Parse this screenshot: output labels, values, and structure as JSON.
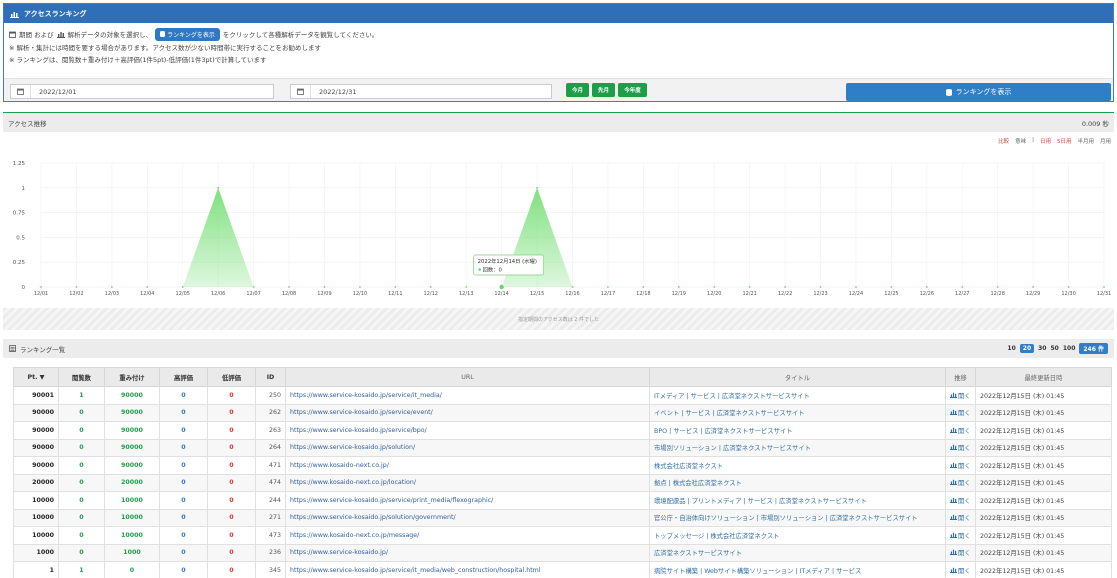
{
  "top_panel": {
    "title": "アクセスランキング",
    "instr_prefix": "期間 および",
    "instr_mid": "解析データの対象を選択し、",
    "instr_button": "ランキングを表示",
    "instr_suffix": "をクリックして各種解析データを観覧してください。",
    "note1": "※ 解析・集計には時間を要する場合があります。アクセス数が少ない時間帯に実行することをお勧めします",
    "note2": "※ ランキングは、閲覧数＋重み付け＋高評価(1件5pt)-低評価(1件3pt)で計算しています",
    "start_date": "2022/12/01",
    "end_date": "2022/12/31",
    "btn_this_month": "今月",
    "btn_last_month": "先月",
    "btn_this_year": "今年度",
    "show_button": "ランキングを表示"
  },
  "access_panel": {
    "title": "アクセス推移",
    "elapsed": "0.009 秒",
    "controls": {
      "compare": "比較",
      "detail": "意味",
      "sep": "|",
      "day": "日用",
      "d5": "5日用",
      "half": "半月用",
      "month": "月用"
    },
    "footer": "指定期間のアクセス数は 2 件でした"
  },
  "tooltip": {
    "date": "2022年12月14日 (水曜)",
    "value": "回数：0"
  },
  "chart_data": {
    "type": "area",
    "categories": [
      "12/01",
      "12/02",
      "12/03",
      "12/04",
      "12/05",
      "12/06",
      "12/07",
      "12/08",
      "12/09",
      "12/10",
      "12/11",
      "12/12",
      "12/13",
      "12/14",
      "12/15",
      "12/16",
      "12/17",
      "12/18",
      "12/19",
      "12/20",
      "12/21",
      "12/22",
      "12/23",
      "12/24",
      "12/25",
      "12/26",
      "12/27",
      "12/28",
      "12/29",
      "12/30",
      "12/31"
    ],
    "values": [
      0,
      0,
      0,
      0,
      0,
      1,
      0,
      0,
      0,
      0,
      0,
      0,
      0,
      0,
      1,
      0,
      0,
      0,
      0,
      0,
      0,
      0,
      0,
      0,
      0,
      0,
      0,
      0,
      0,
      0,
      0
    ],
    "yticks": [
      "0",
      "0.25",
      "0.5",
      "0.75",
      "1",
      "1.25"
    ],
    "ylim": [
      0,
      1.25
    ],
    "color": "#7fe07f",
    "highlight_index": 13
  },
  "ranking": {
    "title": "ランキング一覧",
    "page_sizes": [
      "10",
      "20",
      "30",
      "50",
      "100"
    ],
    "active_size": "20",
    "total": "246 件",
    "headers": {
      "pt": "Pt. ▼",
      "views": "閲覧数",
      "weight": "重み付け",
      "good": "高評価",
      "bad": "低評価",
      "id": "ID",
      "url": "URL",
      "title": "タイトル",
      "trend": "推移",
      "updated": "最終更新日時"
    },
    "rows": [
      {
        "pt": "90001",
        "views": "1",
        "weight": "90000",
        "good": "0",
        "bad": "0",
        "id": "250",
        "url": "https://www.service-kosaido.jp/service/it_media/",
        "title": "ITメディア | サービス | 広済堂ネクストサービスサイト",
        "trend": "開く",
        "updated": "2022年12月15日 (木) 01:45"
      },
      {
        "pt": "90000",
        "views": "0",
        "weight": "90000",
        "good": "0",
        "bad": "0",
        "id": "262",
        "url": "https://www.service-kosaido.jp/service/event/",
        "title": "イベント | サービス | 広済堂ネクストサービスサイト",
        "trend": "開く",
        "updated": "2022年12月15日 (木) 01:45"
      },
      {
        "pt": "90000",
        "views": "0",
        "weight": "90000",
        "good": "0",
        "bad": "0",
        "id": "263",
        "url": "https://www.service-kosaido.jp/service/bpo/",
        "title": "BPO | サービス | 広済堂ネクストサービスサイト",
        "trend": "開く",
        "updated": "2022年12月15日 (木) 01:45"
      },
      {
        "pt": "90000",
        "views": "0",
        "weight": "90000",
        "good": "0",
        "bad": "0",
        "id": "264",
        "url": "https://www.service-kosaido.jp/solution/",
        "title": "市場別ソリューション | 広済堂ネクストサービスサイト",
        "trend": "開く",
        "updated": "2022年12月15日 (木) 01:45"
      },
      {
        "pt": "90000",
        "views": "0",
        "weight": "90000",
        "good": "0",
        "bad": "0",
        "id": "471",
        "url": "https://www.kosaido-next.co.jp/",
        "title": "株式会社広済堂ネクスト",
        "trend": "開く",
        "updated": "2022年12月15日 (木) 01:45"
      },
      {
        "pt": "20000",
        "views": "0",
        "weight": "20000",
        "good": "0",
        "bad": "0",
        "id": "474",
        "url": "https://www.kosaido-next.co.jp/location/",
        "title": "拠点 | 株式会社広済堂ネクスト",
        "trend": "開く",
        "updated": "2022年12月15日 (木) 01:45"
      },
      {
        "pt": "10000",
        "views": "0",
        "weight": "10000",
        "good": "0",
        "bad": "0",
        "id": "244",
        "url": "https://www.service-kosaido.jp/service/print_media/flexographic/",
        "title": "環境配慮品 | プリントメディア | サービス | 広済堂ネクストサービスサイト",
        "trend": "開く",
        "updated": "2022年12月15日 (木) 01:45"
      },
      {
        "pt": "10000",
        "views": "0",
        "weight": "10000",
        "good": "0",
        "bad": "0",
        "id": "271",
        "url": "https://www.service-kosaido.jp/solution/government/",
        "title": "官公庁・自治体向けソリューション | 市場別ソリューション | 広済堂ネクストサービスサイト",
        "trend": "開く",
        "updated": "2022年12月15日 (木) 01:45"
      },
      {
        "pt": "10000",
        "views": "0",
        "weight": "10000",
        "good": "0",
        "bad": "0",
        "id": "473",
        "url": "https://www.kosaido-next.co.jp/message/",
        "title": "トップメッセージ | 株式会社広済堂ネクスト",
        "trend": "開く",
        "updated": "2022年12月15日 (木) 01:45"
      },
      {
        "pt": "1000",
        "views": "0",
        "weight": "1000",
        "good": "0",
        "bad": "0",
        "id": "236",
        "url": "https://www.service-kosaido.jp/",
        "title": "広済堂ネクストサービスサイト",
        "trend": "開く",
        "updated": "2022年12月15日 (木) 01:45"
      },
      {
        "pt": "1",
        "views": "1",
        "weight": "0",
        "good": "0",
        "bad": "0",
        "id": "345",
        "url": "https://www.service-kosaido.jp/service/it_media/web_construction/hospital.html",
        "title": "病院サイト構築 | Webサイト構築ソリューション | ITメディア | サービス",
        "trend": "開く",
        "updated": "2022年12月15日 (木) 01:45"
      }
    ]
  }
}
